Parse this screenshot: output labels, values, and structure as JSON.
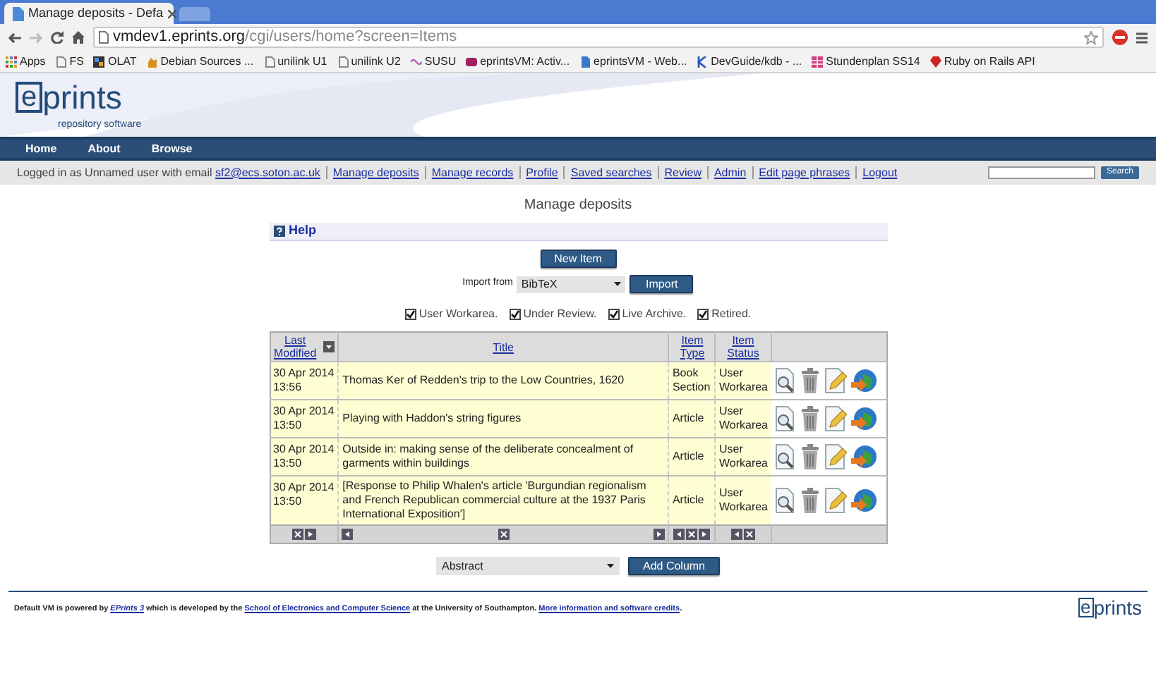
{
  "browser": {
    "tab": {
      "title": "Manage deposits - Defa",
      "selected": true
    },
    "url": {
      "host": "vmdev1.eprints.org",
      "path": "/cgi/users/home?screen=Items"
    },
    "bookmarks": [
      "Apps",
      "FS",
      "OLAT",
      "Debian Sources ...",
      "unilink U1",
      "unilink U2",
      "SUSU",
      "eprintsVM: Activ...",
      "eprintsVM - Web...",
      "DevGuide/kdb - ...",
      "Stundenplan SS14",
      "Ruby on Rails API"
    ]
  },
  "header": {
    "logo_word": "prints",
    "logo_letter": "e",
    "tagline": "repository software",
    "nav": [
      "Home",
      "About",
      "Browse"
    ]
  },
  "user_bar": {
    "intro": [
      {
        "kind": "text",
        "text": "Logged in as Unnamed user with email "
      },
      {
        "kind": "link",
        "text": "sf2@ecs.soton.ac.uk"
      }
    ],
    "links": [
      "Manage deposits",
      "Manage records",
      "Profile",
      "Saved searches",
      "Review",
      "Admin",
      "Edit page phrases",
      "Logout"
    ],
    "search_button": "Search"
  },
  "page_title": "Manage deposits",
  "help": "Help",
  "new_item": "New Item",
  "import": {
    "label": "Import from",
    "format": "BibTeX",
    "button": "Import"
  },
  "filters": [
    {
      "label": "User Workarea.",
      "checked": true
    },
    {
      "label": "Under Review.",
      "checked": true
    },
    {
      "label": "Live Archive.",
      "checked": true
    },
    {
      "label": "Retired.",
      "checked": true
    }
  ],
  "table": {
    "columns": [
      {
        "label": "Last Modified",
        "sorted": true
      },
      {
        "label": "Title",
        "sorted": false
      },
      {
        "label": "Item Type",
        "sorted": false
      },
      {
        "label": "Item Status",
        "sorted": false
      }
    ],
    "rows": [
      {
        "date": "30 Apr 2014",
        "time": "13:56",
        "title": "Thomas Ker of Redden's trip to the Low Countries, 1620",
        "type": "Book Section",
        "status": "User Workarea"
      },
      {
        "date": "30 Apr 2014",
        "time": "13:50",
        "title": "Playing with Haddon's string figures",
        "type": "Article",
        "status": "User Workarea"
      },
      {
        "date": "30 Apr 2014",
        "time": "13:50",
        "title": "Outside in: making sense of the deliberate concealment of garments within buildings",
        "type": "Article",
        "status": "User Workarea"
      },
      {
        "date": "30 Apr 2014",
        "time": "13:50",
        "title": "[Response to Philip Whalen's article 'Burgundian regionalism and French Republican commercial culture at the 1937 Paris International Exposition']",
        "type": "Article",
        "status": "User Workarea"
      }
    ]
  },
  "add_column": {
    "field": "Abstract",
    "button": "Add Column"
  },
  "footer": {
    "parts": [
      {
        "kind": "text",
        "text": "Default VM is powered by "
      },
      {
        "kind": "link",
        "text": "EPrints 3",
        "italic": true
      },
      {
        "kind": "text",
        "text": " which is developed by the "
      },
      {
        "kind": "link",
        "text": "School of Electronics and Computer Science"
      },
      {
        "kind": "text",
        "text": " at the University of Southampton. "
      },
      {
        "kind": "link",
        "text": "More information and software credits"
      },
      {
        "kind": "text",
        "text": "."
      }
    ],
    "logo_letter": "e",
    "logo_word": "prints"
  }
}
